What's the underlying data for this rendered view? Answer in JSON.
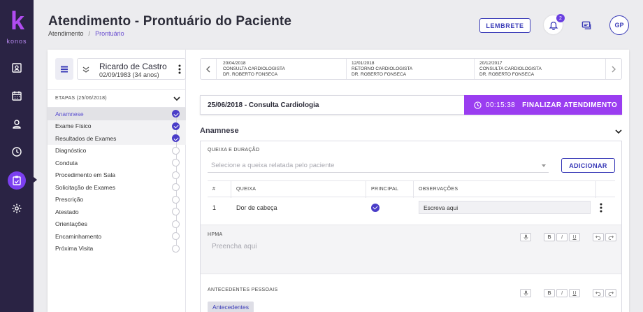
{
  "brand": {
    "name": "konos",
    "mark": "k"
  },
  "nav": {
    "icons": [
      "id-card-icon",
      "calendar-icon",
      "user-icon",
      "clock-icon",
      "clipboard-icon",
      "gear-icon"
    ],
    "active": 4
  },
  "header": {
    "title": "Atendimento - Prontuário do Paciente",
    "breadcrumb": [
      "Atendimento",
      "/",
      "Prontuário"
    ],
    "reminder_label": "LEMBRETE",
    "notification_count": "2",
    "avatar_initials": "GP"
  },
  "patient": {
    "name": "Ricardo de Castro",
    "dob": "02/09/1983 (34 anos)"
  },
  "timeline": [
    {
      "date": "20/04/2018",
      "type": "CONSULTA CARDIOLOGISTA",
      "doctor": "DR. ROBERTO FONSECA"
    },
    {
      "date": "12/01/2018",
      "type": "RETORNO CARDIOLOGISTA",
      "doctor": "DR. ROBERTO FONSECA"
    },
    {
      "date": "20/12/2017",
      "type": "CONSULTA CARDIOLOGISTA",
      "doctor": "DR. ROBERTO FONSECA"
    }
  ],
  "etapas": {
    "header": "ETAPAS (25/06/2018)",
    "steps": [
      {
        "label": "Anamnese",
        "done": true,
        "active": true
      },
      {
        "label": "Exame Físico",
        "done": true
      },
      {
        "label": "Resultados de Exames",
        "done": true
      },
      {
        "label": "Diagnóstico",
        "done": false
      },
      {
        "label": "Conduta",
        "done": false
      },
      {
        "label": "Procedimento em Sala",
        "done": false
      },
      {
        "label": "Solicitação de Exames",
        "done": false
      },
      {
        "label": "Prescrição",
        "done": false
      },
      {
        "label": "Atestado",
        "done": false
      },
      {
        "label": "Orientações",
        "done": false
      },
      {
        "label": "Encaminhamento",
        "done": false
      },
      {
        "label": "Próxima Visita",
        "done": false
      }
    ]
  },
  "consult": {
    "title": "25/06/2018 - Consulta Cardiologia",
    "timer": "00:15:38",
    "finalize_label": "FINALIZAR ATENDIMENTO"
  },
  "anamnese": {
    "title": "Anamnese",
    "queixa_label": "QUEIXA E DURAÇÃO",
    "queixa_placeholder": "Selecione a queixa relatada pelo paciente",
    "add_label": "ADICIONAR",
    "table": {
      "headers": [
        "#",
        "QUEIXA",
        "PRINCIPAL",
        "OBSERVAÇÕES"
      ],
      "rows": [
        {
          "num": "1",
          "queixa": "Dor de cabeça",
          "principal": true,
          "obs": "Escreva aqui"
        }
      ]
    },
    "hpma_label": "HPMA",
    "hpma_placeholder": "Preencha aqui",
    "antecedentes_label": "ANTECEDENTES PESSOAIS",
    "antecedentes_chip": "Antecedentes",
    "toolbar": {
      "bold": "B",
      "italic": "I",
      "underline": "U"
    }
  },
  "colors": {
    "sidebar": "#2a2344",
    "accent": "#7b3ff0",
    "primary": "#3b3cb8",
    "finalize": "#9a3df0",
    "check": "#4a3dc8"
  }
}
